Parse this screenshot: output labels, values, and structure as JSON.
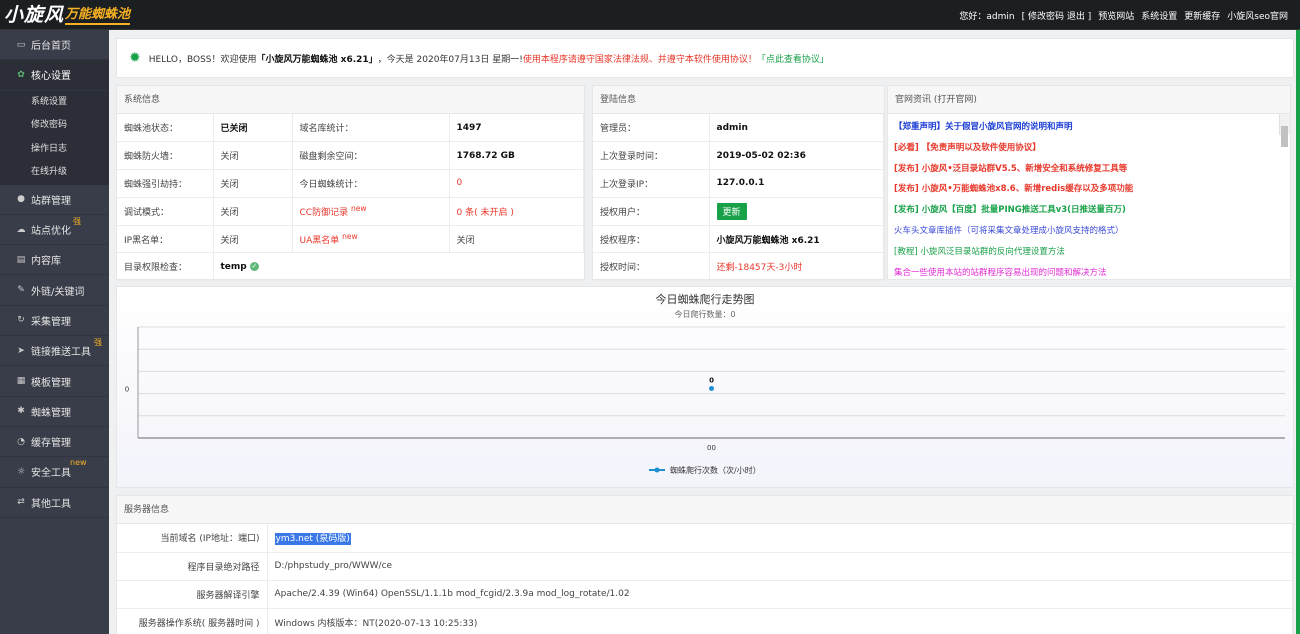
{
  "topbar": {
    "logo_text_1": "小旋风",
    "logo_text_2": "万能蜘蛛池",
    "greeting": "您好：admin",
    "account_links": "[ 修改密码 退出 ]",
    "nav": [
      "预览网站",
      "系统设置",
      "更新缓存",
      "小旋风seo官网"
    ]
  },
  "sidebar": {
    "items": [
      {
        "label": "后台首页",
        "icon": "monitor-icon"
      },
      {
        "label": "核心设置",
        "icon": "gear-icon"
      },
      {
        "label": "站群管理",
        "icon": "user-icon"
      },
      {
        "label": "站点优化",
        "icon": "cloud-icon",
        "badge": "强"
      },
      {
        "label": "内容库",
        "icon": "file-icon"
      },
      {
        "label": "外链/关键词",
        "icon": "pencil-icon"
      },
      {
        "label": "采集管理",
        "icon": "refresh-icon"
      },
      {
        "label": "链接推送工具",
        "icon": "send-icon",
        "badge": "强"
      },
      {
        "label": "模板管理",
        "icon": "grid-icon"
      },
      {
        "label": "蜘蛛管理",
        "icon": "bug-icon"
      },
      {
        "label": "缓存管理",
        "icon": "dashboard-icon"
      },
      {
        "label": "安全工具",
        "icon": "bulb-icon",
        "badge": "new"
      },
      {
        "label": "其他工具",
        "icon": "shuffle-icon"
      }
    ],
    "sub_items": [
      "系统设置",
      "修改密码",
      "操作日志",
      "在线升级"
    ]
  },
  "welcome": {
    "prefix": "HELLO，BOSS！欢迎使用",
    "product": "「小旋风万能蜘蛛池 x6.21」",
    "date_text": "，今天是 2020年07月13日 星期一!",
    "warning": "使用本程序请遵守国家法律法规、并遵守本软件使用协议！",
    "agreement_link": "「点此查看协议」"
  },
  "system_info": {
    "title": "系统信息",
    "rows": [
      [
        "蜘蛛池状态：",
        "已关闭",
        "域名库统计：",
        "1497"
      ],
      [
        "蜘蛛防火墙：",
        "关闭",
        "磁盘剩余空间：",
        "1768.72 GB"
      ],
      [
        "蜘蛛强引劫持：",
        "关闭",
        "今日蜘蛛统计：",
        "0"
      ],
      [
        "调试模式：",
        "关闭",
        "CC防御记录",
        "0 条( 未开启 )"
      ],
      [
        "IP黑名单：",
        "关闭",
        "UA黑名单",
        "关闭"
      ],
      [
        "目录权限检查：",
        "temp",
        "",
        ""
      ]
    ],
    "new_tag": "new"
  },
  "login_info": {
    "title": "登陆信息",
    "rows": [
      [
        "管理员：",
        "admin"
      ],
      [
        "上次登录时间：",
        "2019-05-02 02:36"
      ],
      [
        "上次登录IP：",
        "127.0.0.1"
      ],
      [
        "授权用户：",
        "更新"
      ],
      [
        "授权程序：",
        "小旋风万能蜘蛛池 x6.21"
      ],
      [
        "授权时间：",
        "还剩-18457天-3小时"
      ]
    ]
  },
  "news": {
    "title": "官网资讯 (打开官网)",
    "items": [
      {
        "text": "【郑重声明】关于假冒小旋风官网的说明和声明",
        "color": "#1e3fd6"
      },
      {
        "text": "[必看] 【免责声明以及软件使用协议】",
        "color": "#e8382b"
      },
      {
        "text": "[发布] 小旋风•泛目录站群V5.5、新增安全和系统修复工具等",
        "color": "#e8382b"
      },
      {
        "text": "[发布] 小旋风•万能蜘蛛池x8.6、新增redis缓存以及多项功能",
        "color": "#e8382b"
      },
      {
        "text": "[发布] 小旋风【百度】批量PING推送工具v3(日推送量百万)",
        "color": "#19a14a"
      },
      {
        "text": "火车头文章库插件（可将采集文章处理成小旋风支持的格式）",
        "color": "#3b4bd6"
      },
      {
        "text": "[教程] 小旋风泛目录站群的反向代理设置方法",
        "color": "#19a14a"
      },
      {
        "text": "集合一些使用本站的站群程序容易出现的问题和解决方法",
        "color": "#e22ad6"
      }
    ]
  },
  "chart_data": {
    "type": "line",
    "title": "今日蜘蛛爬行走势图",
    "subtitle": "今日爬行数量：0",
    "categories": [
      "00"
    ],
    "series": [
      {
        "name": "蜘蛛爬行次数（次/小时）",
        "values": [
          0
        ]
      }
    ],
    "y_tick_labels": [
      "0"
    ],
    "data_labels": [
      "0"
    ],
    "grid": true,
    "legend": "bottom"
  },
  "server_info": {
    "title": "服务器信息",
    "rows": [
      [
        "当前域名 (IP地址：端口)",
        "ym3.net (泉码版)"
      ],
      [
        "程序目录绝对路径",
        "D:/phpstudy_pro/WWW/ce"
      ],
      [
        "服务器解译引擎",
        "Apache/2.4.39 (Win64) OpenSSL/1.1.1b mod_fcgid/2.3.9a mod_log_rotate/1.02"
      ],
      [
        "服务器操作系统( 服务器时间 )",
        "Windows 内核版本：NT(2020-07-13 10:25:33)"
      ]
    ]
  },
  "colors": {
    "accent": "#19a14a",
    "sidebar": "#393d49",
    "topbar": "#1c1f22",
    "warning": "#e8382b"
  }
}
